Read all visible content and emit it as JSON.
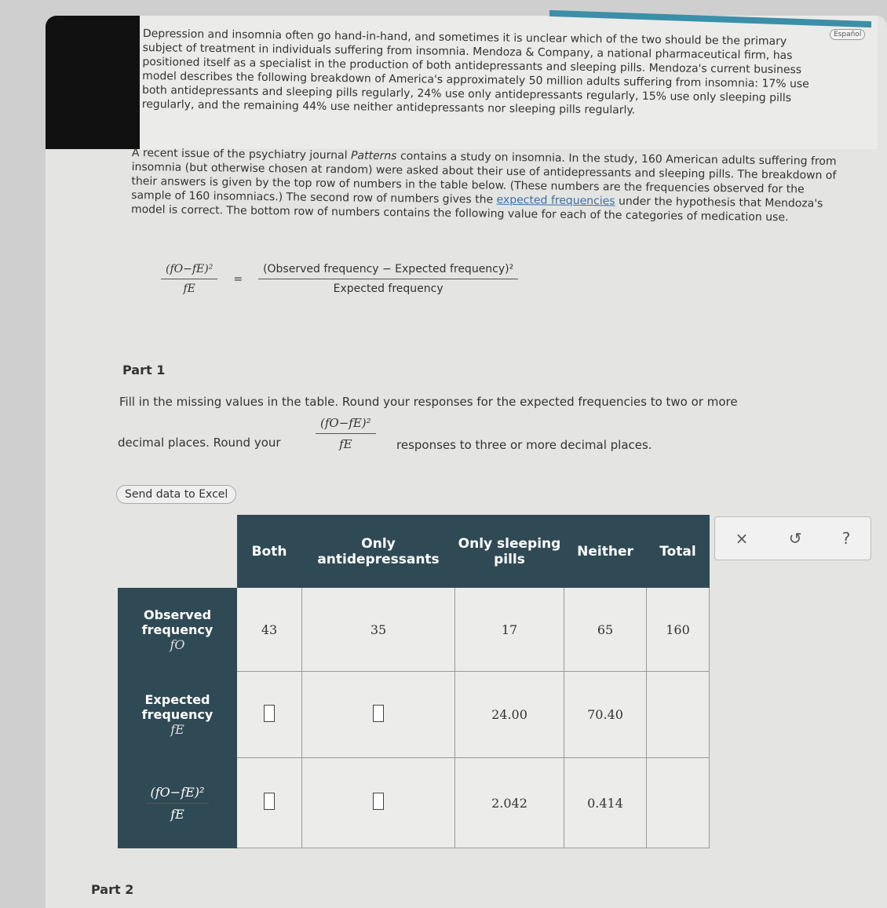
{
  "header": {
    "language_button": "Español"
  },
  "intro": {
    "paragraph1": "Depression and insomnia often go hand-in-hand, and sometimes it is unclear which of the two should be the primary subject of treatment in individuals suffering from insomnia. Mendoza & Company, a national pharmaceutical firm, has positioned itself as a specialist in the production of both antidepressants and sleeping pills. Mendoza's current business model describes the following breakdown of America's approximately 50 million adults suffering from insomnia: 17% use both antidepressants and sleeping pills regularly, 24% use only antidepressants regularly, 15% use only sleeping pills regularly, and the remaining 44% use neither antidepressants nor sleeping pills regularly.",
    "paragraph2_a": "A recent issue of the psychiatry journal ",
    "journal": "Patterns",
    "paragraph2_b": " contains a study on insomnia. In the study, 160 American adults suffering from insomnia (but otherwise chosen at random) were asked about their use of antidepressants and sleeping pills. The breakdown of their answers is given by the top row of numbers in the table below. (These numbers are the frequencies observed for the sample of 160 insomniacs.) The second row of numbers gives the ",
    "link": "expected frequencies",
    "paragraph2_c": " under the hypothesis that Mendoza's model is correct. The bottom row of numbers contains the following value for each of the categories of medication use."
  },
  "formula": {
    "lhs_num": "(fO−fE)²",
    "lhs_den": "fE",
    "equals": "=",
    "rhs_num": "(Observed frequency − Expected frequency)²",
    "rhs_den": "Expected frequency"
  },
  "part1": {
    "title": "Part 1",
    "instr_a": "Fill in the missing values in the table. Round your responses for the expected frequencies to two or more",
    "instr_b": "decimal places. Round your",
    "instr_c": "responses to three or more decimal places.",
    "excel_button": "Send data to Excel"
  },
  "table": {
    "columns": [
      "Both",
      "Only antidepressants",
      "Only sleeping pills",
      "Neither",
      "Total"
    ],
    "rows": [
      {
        "label": "Observed frequency",
        "symbol": "fO",
        "values": [
          "43",
          "35",
          "17",
          "65",
          "160"
        ]
      },
      {
        "label": "Expected frequency",
        "symbol": "fE",
        "values": [
          "",
          "",
          "24.00",
          "70.40",
          ""
        ]
      },
      {
        "label": "(fO−fE)² / fE",
        "symbol": "",
        "values": [
          "",
          "",
          "2.042",
          "0.414",
          ""
        ]
      }
    ]
  },
  "tools": {
    "clear": "×",
    "undo": "↺",
    "help": "?"
  },
  "part2": {
    "title": "Part 2"
  },
  "colors": {
    "table_header": "#2f4a55",
    "link": "#3a6fa8"
  }
}
